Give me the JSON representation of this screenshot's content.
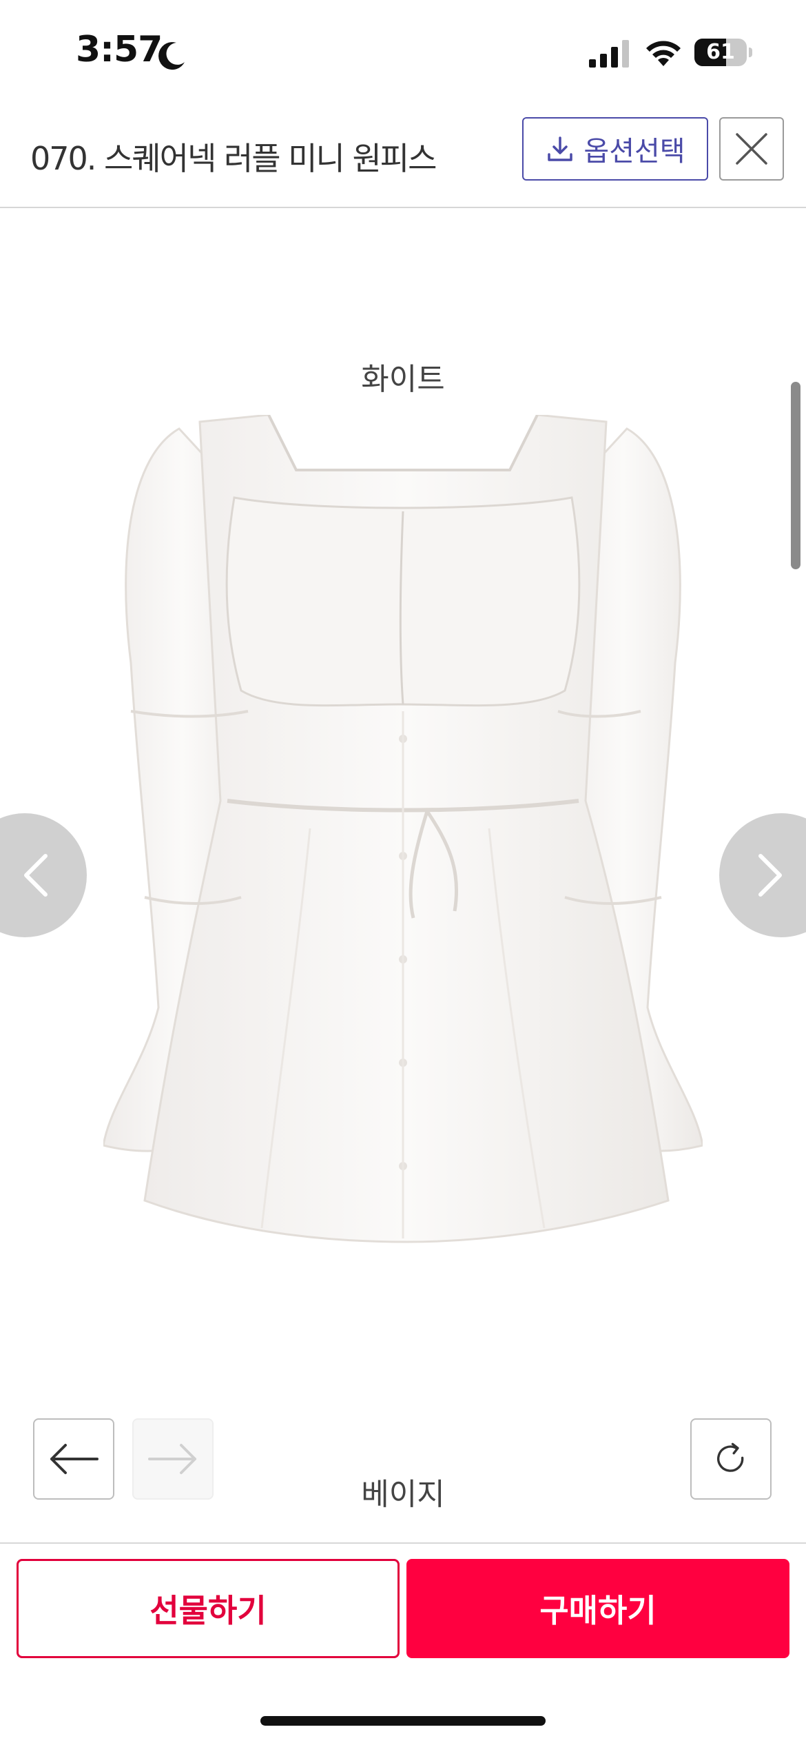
{
  "status_bar": {
    "time": "3:57",
    "battery_percent": "61",
    "battery_level": 0.61,
    "icons": [
      "moon-icon",
      "signal-icon",
      "wifi-icon",
      "battery-icon"
    ]
  },
  "header": {
    "title": "070. 스퀘어넥 러플 미니 원피스",
    "option_button_label": "옵션선택",
    "option_button_icon": "download-icon",
    "close_icon": "close-icon"
  },
  "content": {
    "color_labels": [
      "화이트",
      "베이지"
    ]
  },
  "bottom_bar": {
    "gift_label": "선물하기",
    "buy_label": "구매하기"
  },
  "colors": {
    "accent_red": "#ff0040",
    "accent_purple": "#4a4aa8"
  }
}
